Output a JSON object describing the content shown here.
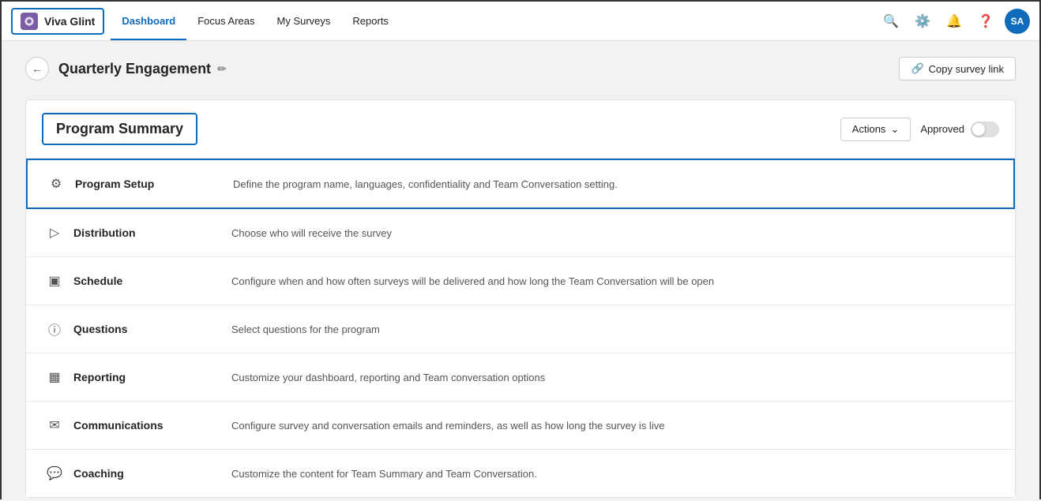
{
  "brand": {
    "name": "Viva Glint"
  },
  "nav": {
    "links": [
      {
        "label": "Dashboard",
        "active": true
      },
      {
        "label": "Focus Areas",
        "active": false
      },
      {
        "label": "My Surveys",
        "active": false
      },
      {
        "label": "Reports",
        "active": false
      }
    ],
    "avatar_initials": "SA"
  },
  "page": {
    "title": "Quarterly Engagement",
    "copy_btn_label": "Copy survey link"
  },
  "program_summary": {
    "title": "Program Summary",
    "actions_label": "Actions",
    "approved_label": "Approved",
    "items": [
      {
        "name": "Program Setup",
        "description": "Define the program name, languages, confidentiality and Team Conversation setting.",
        "icon": "⚙",
        "active": true
      },
      {
        "name": "Distribution",
        "description": "Choose who will receive the survey",
        "icon": "▷",
        "active": false
      },
      {
        "name": "Schedule",
        "description": "Configure when and how often surveys will be delivered and how long the Team Conversation will be open",
        "icon": "▣",
        "active": false
      },
      {
        "name": "Questions",
        "description": "Select questions for the program",
        "icon": "?",
        "active": false
      },
      {
        "name": "Reporting",
        "description": "Customize your dashboard, reporting and Team conversation options",
        "icon": "▦",
        "active": false
      },
      {
        "name": "Communications",
        "description": "Configure survey and conversation emails and reminders, as well as how long the survey is live",
        "icon": "✉",
        "active": false
      },
      {
        "name": "Coaching",
        "description": "Customize the content for Team Summary and Team Conversation.",
        "icon": "💬",
        "active": false
      }
    ]
  }
}
